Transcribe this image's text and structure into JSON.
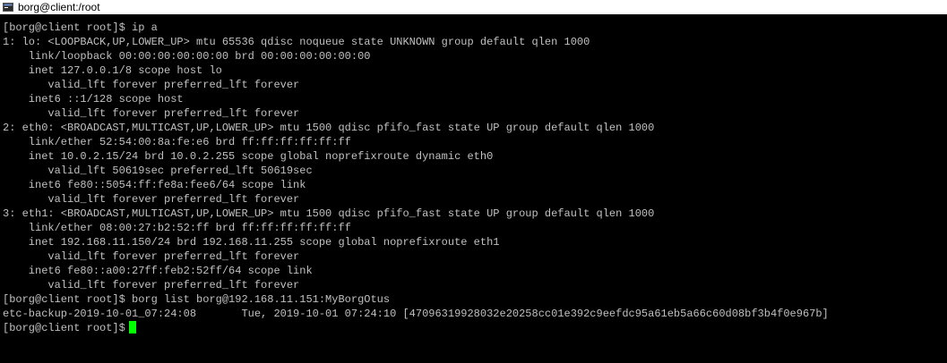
{
  "window": {
    "title": "borg@client:/root"
  },
  "terminal": {
    "text_color": "#c0c0c0",
    "background_color": "#000000",
    "cursor_color": "#00ff00",
    "lines": [
      "[borg@client root]$ ip a",
      "1: lo: <LOOPBACK,UP,LOWER_UP> mtu 65536 qdisc noqueue state UNKNOWN group default qlen 1000",
      "    link/loopback 00:00:00:00:00:00 brd 00:00:00:00:00:00",
      "    inet 127.0.0.1/8 scope host lo",
      "       valid_lft forever preferred_lft forever",
      "    inet6 ::1/128 scope host",
      "       valid_lft forever preferred_lft forever",
      "2: eth0: <BROADCAST,MULTICAST,UP,LOWER_UP> mtu 1500 qdisc pfifo_fast state UP group default qlen 1000",
      "    link/ether 52:54:00:8a:fe:e6 brd ff:ff:ff:ff:ff:ff",
      "    inet 10.0.2.15/24 brd 10.0.2.255 scope global noprefixroute dynamic eth0",
      "       valid_lft 50619sec preferred_lft 50619sec",
      "    inet6 fe80::5054:ff:fe8a:fee6/64 scope link",
      "       valid_lft forever preferred_lft forever",
      "3: eth1: <BROADCAST,MULTICAST,UP,LOWER_UP> mtu 1500 qdisc pfifo_fast state UP group default qlen 1000",
      "    link/ether 08:00:27:b2:52:ff brd ff:ff:ff:ff:ff:ff",
      "    inet 192.168.11.150/24 brd 192.168.11.255 scope global noprefixroute eth1",
      "       valid_lft forever preferred_lft forever",
      "    inet6 fe80::a00:27ff:feb2:52ff/64 scope link",
      "       valid_lft forever preferred_lft forever",
      "[borg@client root]$ borg list borg@192.168.11.151:MyBorgOtus",
      "etc-backup-2019-10-01_07:24:08       Tue, 2019-10-01 07:24:10 [47096319928032e20258cc01e392c9eefdc95a61eb5a66c60d08bf3b4f0e967b]",
      "[borg@client root]$"
    ]
  }
}
